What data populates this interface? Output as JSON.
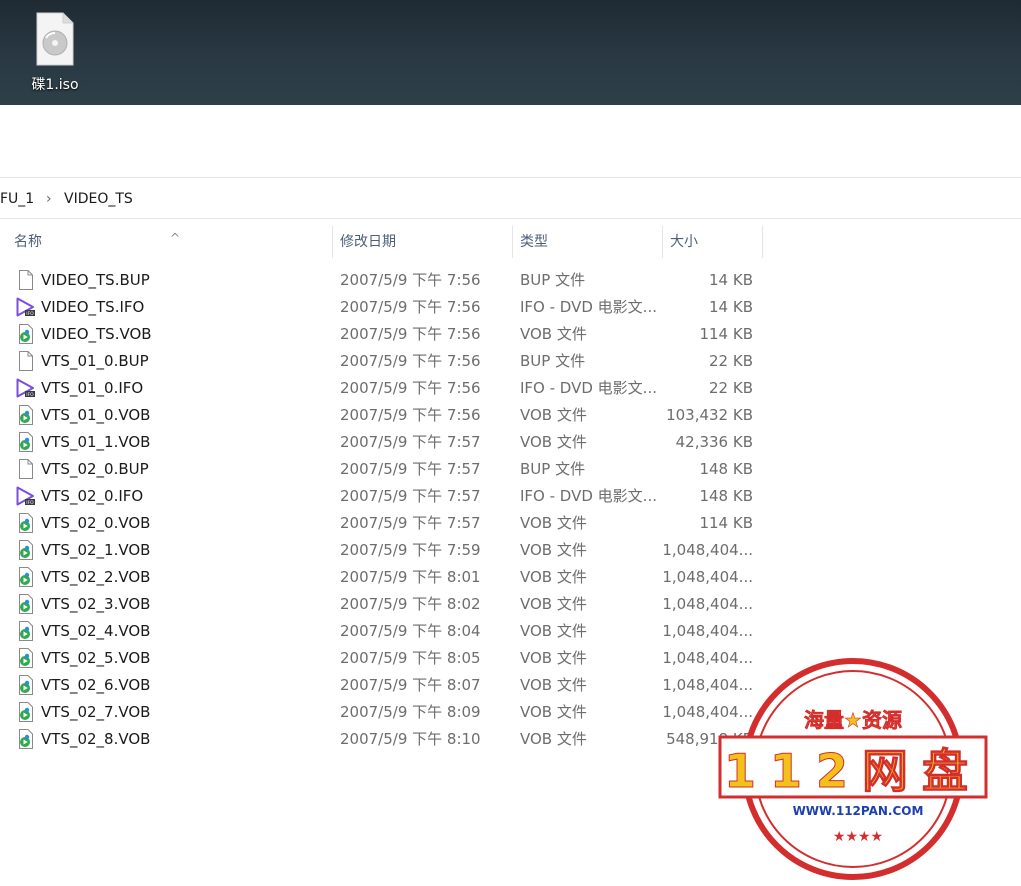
{
  "desktop": {
    "icon_label": "碟1.iso",
    "icon": "disc-image-file-icon"
  },
  "address": {
    "parent": "FU_1",
    "separator": "›",
    "current": "VIDEO_TS"
  },
  "columns": {
    "name": "名称",
    "date": "修改日期",
    "type": "类型",
    "size": "大小",
    "sort_indicator": "^"
  },
  "files": [
    {
      "name": "VIDEO_TS.BUP",
      "date": "2007/5/9 下午 7:56",
      "type": "BUP 文件",
      "size": "14 KB",
      "icon": "blank-file-icon"
    },
    {
      "name": "VIDEO_TS.IFO",
      "date": "2007/5/9 下午 7:56",
      "type": "IFO - DVD 电影文...",
      "size": "14 KB",
      "icon": "ifo-play-icon"
    },
    {
      "name": "VIDEO_TS.VOB",
      "date": "2007/5/9 下午 7:56",
      "type": "VOB 文件",
      "size": "114 KB",
      "icon": "vob-media-icon"
    },
    {
      "name": "VTS_01_0.BUP",
      "date": "2007/5/9 下午 7:56",
      "type": "BUP 文件",
      "size": "22 KB",
      "icon": "blank-file-icon"
    },
    {
      "name": "VTS_01_0.IFO",
      "date": "2007/5/9 下午 7:56",
      "type": "IFO - DVD 电影文...",
      "size": "22 KB",
      "icon": "ifo-play-icon"
    },
    {
      "name": "VTS_01_0.VOB",
      "date": "2007/5/9 下午 7:56",
      "type": "VOB 文件",
      "size": "103,432 KB",
      "icon": "vob-media-icon"
    },
    {
      "name": "VTS_01_1.VOB",
      "date": "2007/5/9 下午 7:57",
      "type": "VOB 文件",
      "size": "42,336 KB",
      "icon": "vob-media-icon"
    },
    {
      "name": "VTS_02_0.BUP",
      "date": "2007/5/9 下午 7:57",
      "type": "BUP 文件",
      "size": "148 KB",
      "icon": "blank-file-icon"
    },
    {
      "name": "VTS_02_0.IFO",
      "date": "2007/5/9 下午 7:57",
      "type": "IFO - DVD 电影文...",
      "size": "148 KB",
      "icon": "ifo-play-icon"
    },
    {
      "name": "VTS_02_0.VOB",
      "date": "2007/5/9 下午 7:57",
      "type": "VOB 文件",
      "size": "114 KB",
      "icon": "vob-media-icon"
    },
    {
      "name": "VTS_02_1.VOB",
      "date": "2007/5/9 下午 7:59",
      "type": "VOB 文件",
      "size": "1,048,404...",
      "icon": "vob-media-icon"
    },
    {
      "name": "VTS_02_2.VOB",
      "date": "2007/5/9 下午 8:01",
      "type": "VOB 文件",
      "size": "1,048,404...",
      "icon": "vob-media-icon"
    },
    {
      "name": "VTS_02_3.VOB",
      "date": "2007/5/9 下午 8:02",
      "type": "VOB 文件",
      "size": "1,048,404...",
      "icon": "vob-media-icon"
    },
    {
      "name": "VTS_02_4.VOB",
      "date": "2007/5/9 下午 8:04",
      "type": "VOB 文件",
      "size": "1,048,404...",
      "icon": "vob-media-icon"
    },
    {
      "name": "VTS_02_5.VOB",
      "date": "2007/5/9 下午 8:05",
      "type": "VOB 文件",
      "size": "1,048,404...",
      "icon": "vob-media-icon"
    },
    {
      "name": "VTS_02_6.VOB",
      "date": "2007/5/9 下午 8:07",
      "type": "VOB 文件",
      "size": "1,048,404...",
      "icon": "vob-media-icon"
    },
    {
      "name": "VTS_02_7.VOB",
      "date": "2007/5/9 下午 8:09",
      "type": "VOB 文件",
      "size": "1,048,404...",
      "icon": "vob-media-icon"
    },
    {
      "name": "VTS_02_8.VOB",
      "date": "2007/5/9 下午 8:10",
      "type": "VOB 文件",
      "size": "548,918 KB",
      "icon": "vob-media-icon"
    }
  ],
  "watermark": {
    "top_text": "海量★资源",
    "main_text": "112网盘",
    "url": "WWW.112PAN.COM",
    "stamp_color": "#d42d2d",
    "main_text_color": "#f2c21b"
  },
  "colors": {
    "desktop_bg": "#263540",
    "header_text": "#4c607a",
    "ifo_icon": "#7a4ee0",
    "vob_icon": "#2fa84f"
  }
}
